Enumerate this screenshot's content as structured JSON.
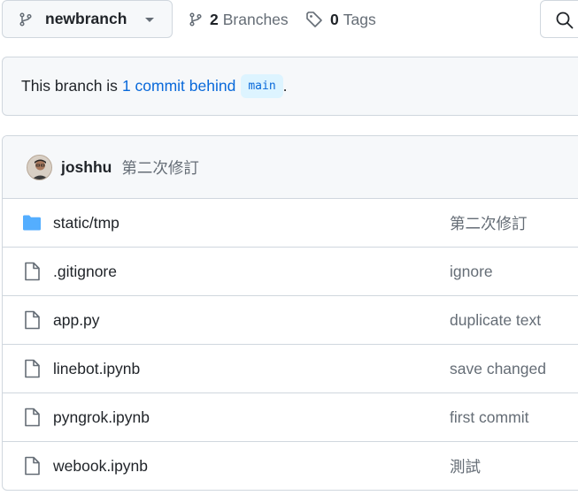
{
  "branch_selector": {
    "label": "newbranch"
  },
  "branches": {
    "count": "2",
    "word": "Branches"
  },
  "tags": {
    "count": "0",
    "word": "Tags"
  },
  "status": {
    "prefix": "This branch is",
    "link": "1 commit behind",
    "target": "main",
    "suffix": "."
  },
  "latest_commit": {
    "author": "joshhu",
    "message": "第二次修訂"
  },
  "files": [
    {
      "type": "folder",
      "name": "static/tmp",
      "commit": "第二次修訂"
    },
    {
      "type": "file",
      "name": ".gitignore",
      "commit": "ignore"
    },
    {
      "type": "file",
      "name": "app.py",
      "commit": "duplicate text"
    },
    {
      "type": "file",
      "name": "linebot.ipynb",
      "commit": "save changed"
    },
    {
      "type": "file",
      "name": "pyngrok.ipynb",
      "commit": "first commit"
    },
    {
      "type": "file",
      "name": "webook.ipynb",
      "commit": "測試"
    }
  ],
  "colors": {
    "accent": "#0969da",
    "folder": "#54aeff",
    "muted": "#656d76",
    "border": "#d0d7de"
  }
}
